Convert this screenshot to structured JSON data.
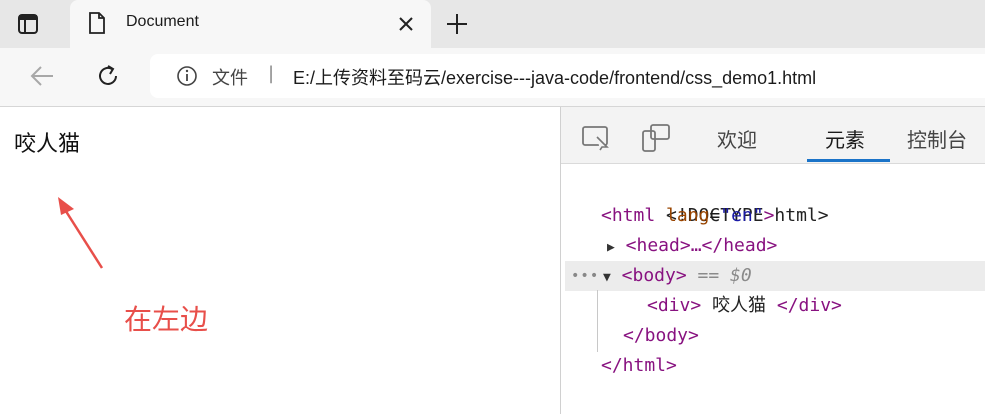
{
  "browser": {
    "tab": {
      "title": "Document"
    },
    "address": {
      "scheme_label": "文件",
      "separator": "|",
      "url": "E:/上传资料至码云/exercise---java-code/frontend/css_demo1.html"
    }
  },
  "page": {
    "div_text": "咬人猫",
    "annotation": "在左边",
    "annotation_color": "#e84f4a"
  },
  "devtools": {
    "tabs": [
      "欢迎",
      "元素",
      "控制台"
    ],
    "active_tab": "元素",
    "dom": {
      "doctype": "<!DOCTYPE html>",
      "html_open": "<html",
      "lang_attr": "lang",
      "lang_val": "\"en\"",
      "html_close_bracket": ">",
      "head_line": "<head>…</head>",
      "body_open": "<body>",
      "selected_marker": "== $0",
      "div_open": "<div>",
      "div_text": " 咬人猫 ",
      "div_close": "</div>",
      "body_close": "</body>",
      "html_close": "</html>"
    },
    "accent_color": "#1a73c8"
  }
}
